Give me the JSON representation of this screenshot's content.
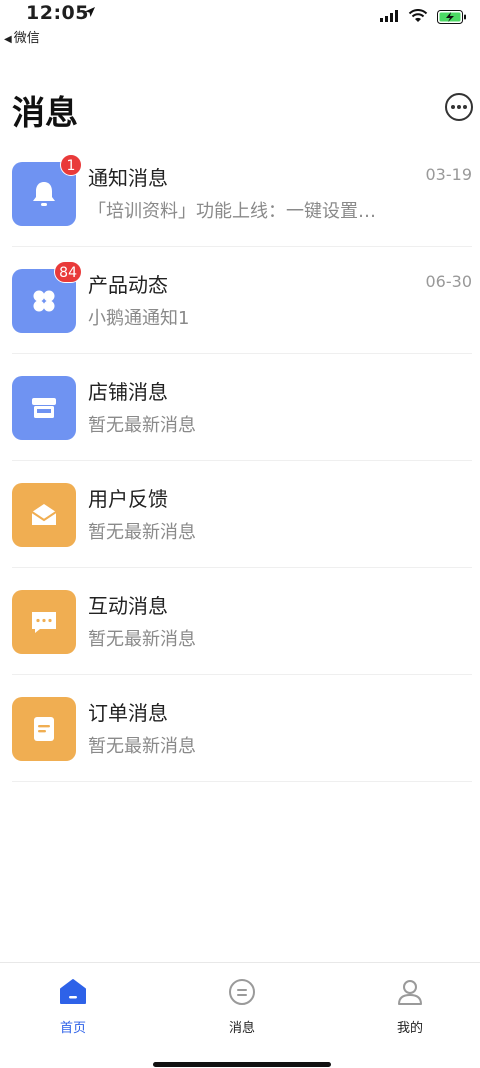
{
  "status": {
    "time": "12:05",
    "back_app": "微信"
  },
  "header": {
    "title": "消息"
  },
  "messages": [
    {
      "title": "通知消息",
      "subtitle": "「培训资料」功能上线：一键设置…",
      "date": "03-19",
      "badge": "1",
      "icon": "bell-icon",
      "color": "#6f93f2"
    },
    {
      "title": "产品动态",
      "subtitle": "小鹅通通知1",
      "date": "06-30",
      "badge": "84",
      "icon": "grid-icon",
      "color": "#6f93f2"
    },
    {
      "title": "店铺消息",
      "subtitle": "暂无最新消息",
      "date": "",
      "badge": "",
      "icon": "store-icon",
      "color": "#6f93f2"
    },
    {
      "title": "用户反馈",
      "subtitle": "暂无最新消息",
      "date": "",
      "badge": "",
      "icon": "envelope-icon",
      "color": "#f0ae52"
    },
    {
      "title": "互动消息",
      "subtitle": "暂无最新消息",
      "date": "",
      "badge": "",
      "icon": "chat-icon",
      "color": "#f0ae52"
    },
    {
      "title": "订单消息",
      "subtitle": "暂无最新消息",
      "date": "",
      "badge": "",
      "icon": "document-icon",
      "color": "#f0ae52"
    }
  ],
  "tabs": [
    {
      "label": "首页",
      "icon": "home-icon",
      "active": true
    },
    {
      "label": "消息",
      "icon": "message-icon",
      "active": false
    },
    {
      "label": "我的",
      "icon": "profile-icon",
      "active": false
    }
  ],
  "colors": {
    "accent": "#2e62e8",
    "badge": "#e93a3a",
    "tile_blue": "#6f93f2",
    "tile_orange": "#f0ae52"
  }
}
